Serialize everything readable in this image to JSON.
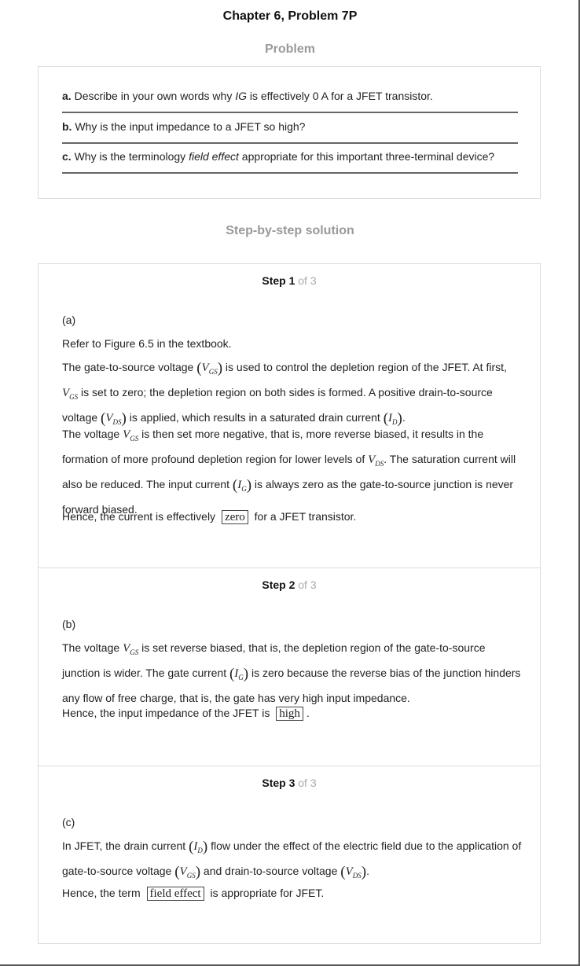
{
  "title": "Chapter 6, Problem 7P",
  "problem_heading": "Problem",
  "problem": {
    "a": {
      "label": "a.",
      "pre": " Describe in your own words why ",
      "em": "IG",
      "post": " is effectively 0 A for a JFET transistor."
    },
    "b": {
      "label": "b.",
      "text": " Why is the input impedance to a JFET so high?"
    },
    "c": {
      "label": "c.",
      "pre": " Why is the terminology ",
      "em": "field effect",
      "post": " appropriate for this important three-terminal device?"
    }
  },
  "solution_heading": "Step-by-step solution",
  "steps": [
    {
      "num": "Step 1",
      "of": " of 3",
      "part": "(a)",
      "p1": "Refer to Figure 6.5 in the textbook.",
      "p2a": "The gate-to-source voltage ",
      "p2b": " is used to control the depletion region of the JFET. At first, ",
      "p2c": " is set to zero; the depletion region on both sides is formed. A positive drain-to-source voltage ",
      "p2d": " is applied, which results in a saturated drain current ",
      "p2e": ".",
      "p3a": "The voltage ",
      "p3b": " is then set more negative, that is, more reverse biased, it results in the formation of more profound depletion region for lower levels of ",
      "p3c": ". The saturation current will also be reduced. The input current ",
      "p3d": " is always zero as the gate-to-source junction is never forward biased.",
      "p4a": "Hence, the current is effectively ",
      "answer": "zero",
      "p4b": " for a JFET transistor."
    },
    {
      "num": "Step 2",
      "of": " of 3",
      "part": "(b)",
      "p1a": "The voltage ",
      "p1b": " is set reverse biased, that is, the depletion region of the gate-to-source junction is wider. The gate current ",
      "p1c": " is zero because the reverse bias of the junction hinders any flow of free charge, that is, the gate has very high input impedance.",
      "p2a": "Hence, the input impedance of the JFET is ",
      "answer": "high",
      "p2b": "."
    },
    {
      "num": "Step 3",
      "of": " of 3",
      "part": "(c)",
      "p1a": "In JFET, the drain current ",
      "p1b": " flow under the effect of the electric field due to the application of gate-to-source voltage ",
      "p1c": " and drain-to-source voltage ",
      "p1d": ".",
      "p2a": "Hence, the term ",
      "answer": "field effect",
      "p2b": " is appropriate for JFET."
    }
  ],
  "math": {
    "V": "V",
    "I": "I",
    "GS": "GS",
    "DS": "DS",
    "D": "D",
    "G": "G",
    "lp": "(",
    "rp": ")"
  }
}
